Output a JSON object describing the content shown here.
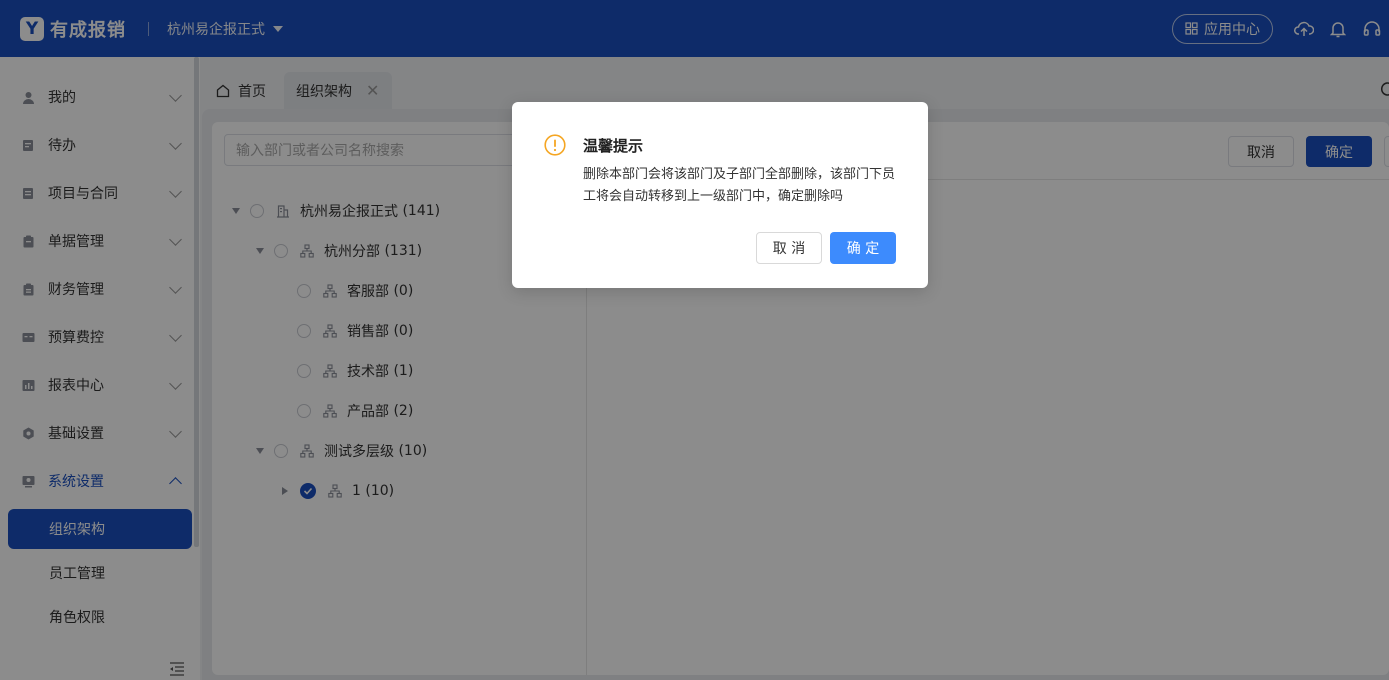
{
  "header": {
    "logo_mark": "Y",
    "logo_text": "有成报销",
    "company": "杭州易企报正式",
    "app_center": "应用中心"
  },
  "sidebar": {
    "items": [
      {
        "label": "我的"
      },
      {
        "label": "待办"
      },
      {
        "label": "项目与合同"
      },
      {
        "label": "单据管理"
      },
      {
        "label": "财务管理"
      },
      {
        "label": "预算费控"
      },
      {
        "label": "报表中心"
      },
      {
        "label": "基础设置"
      },
      {
        "label": "系统设置"
      }
    ],
    "sub_items": [
      {
        "label": "组织架构"
      },
      {
        "label": "员工管理"
      },
      {
        "label": "角色权限"
      }
    ]
  },
  "tabs": {
    "home": "首页",
    "active": "组织架构",
    "close": "✕"
  },
  "toolbar": {
    "search_placeholder": "输入部门或者公司名称搜索",
    "cancel": "取消",
    "confirm": "确定"
  },
  "tree": [
    {
      "label": "杭州易企报正式",
      "count": "(141)"
    },
    {
      "label": "杭州分部",
      "count": "(131)"
    },
    {
      "label": "客服部",
      "count": "(0)"
    },
    {
      "label": "销售部",
      "count": "(0)"
    },
    {
      "label": "技术部",
      "count": "(1)"
    },
    {
      "label": "产品部",
      "count": "(2)"
    },
    {
      "label": "测试多层级",
      "count": "(10)"
    },
    {
      "label": "1",
      "count": "(10)"
    }
  ],
  "modal": {
    "title": "温馨提示",
    "body": "删除本部门会将该部门及子部门全部删除，该部门下员工将会自动转移到上一级部门中，确定删除吗",
    "cancel": "取 消",
    "confirm": "确 定"
  },
  "colors": {
    "brand": "#1a4fbf",
    "modal_primary": "#3d8bfd",
    "warning": "#f5a623"
  }
}
